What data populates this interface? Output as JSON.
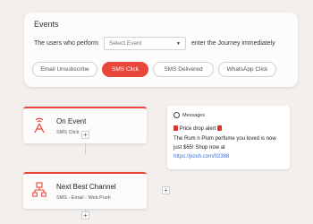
{
  "events": {
    "title": "Events",
    "prefix": "The users who perform",
    "select_placeholder": "Select Event",
    "suffix": "enter the Journey immediately",
    "chips": [
      {
        "label": "Email Unsubscribe",
        "active": false
      },
      {
        "label": "SMS Click",
        "active": true
      },
      {
        "label": "SMS Delivered",
        "active": false
      },
      {
        "label": "WhatsApp Click",
        "active": false
      }
    ]
  },
  "nodes": {
    "on_event": {
      "title": "On Event",
      "subtitle": "SMS Click",
      "icon": "signal-tower-icon"
    },
    "best_channel": {
      "title": "Next Best Channel",
      "subtitle": "SMS - Email - Web Push",
      "icon": "network-hierarchy-icon"
    }
  },
  "message": {
    "app": "Messages",
    "alert_line": "Price drop alert",
    "body_line1": "The Rum n Plum perfume you loved is now",
    "body_line2": "just $65! Shop now at",
    "link": "https://posh.com/02388"
  },
  "colors": {
    "accent": "#e8473a",
    "link": "#3a6fd8",
    "background": "#f2efed"
  }
}
